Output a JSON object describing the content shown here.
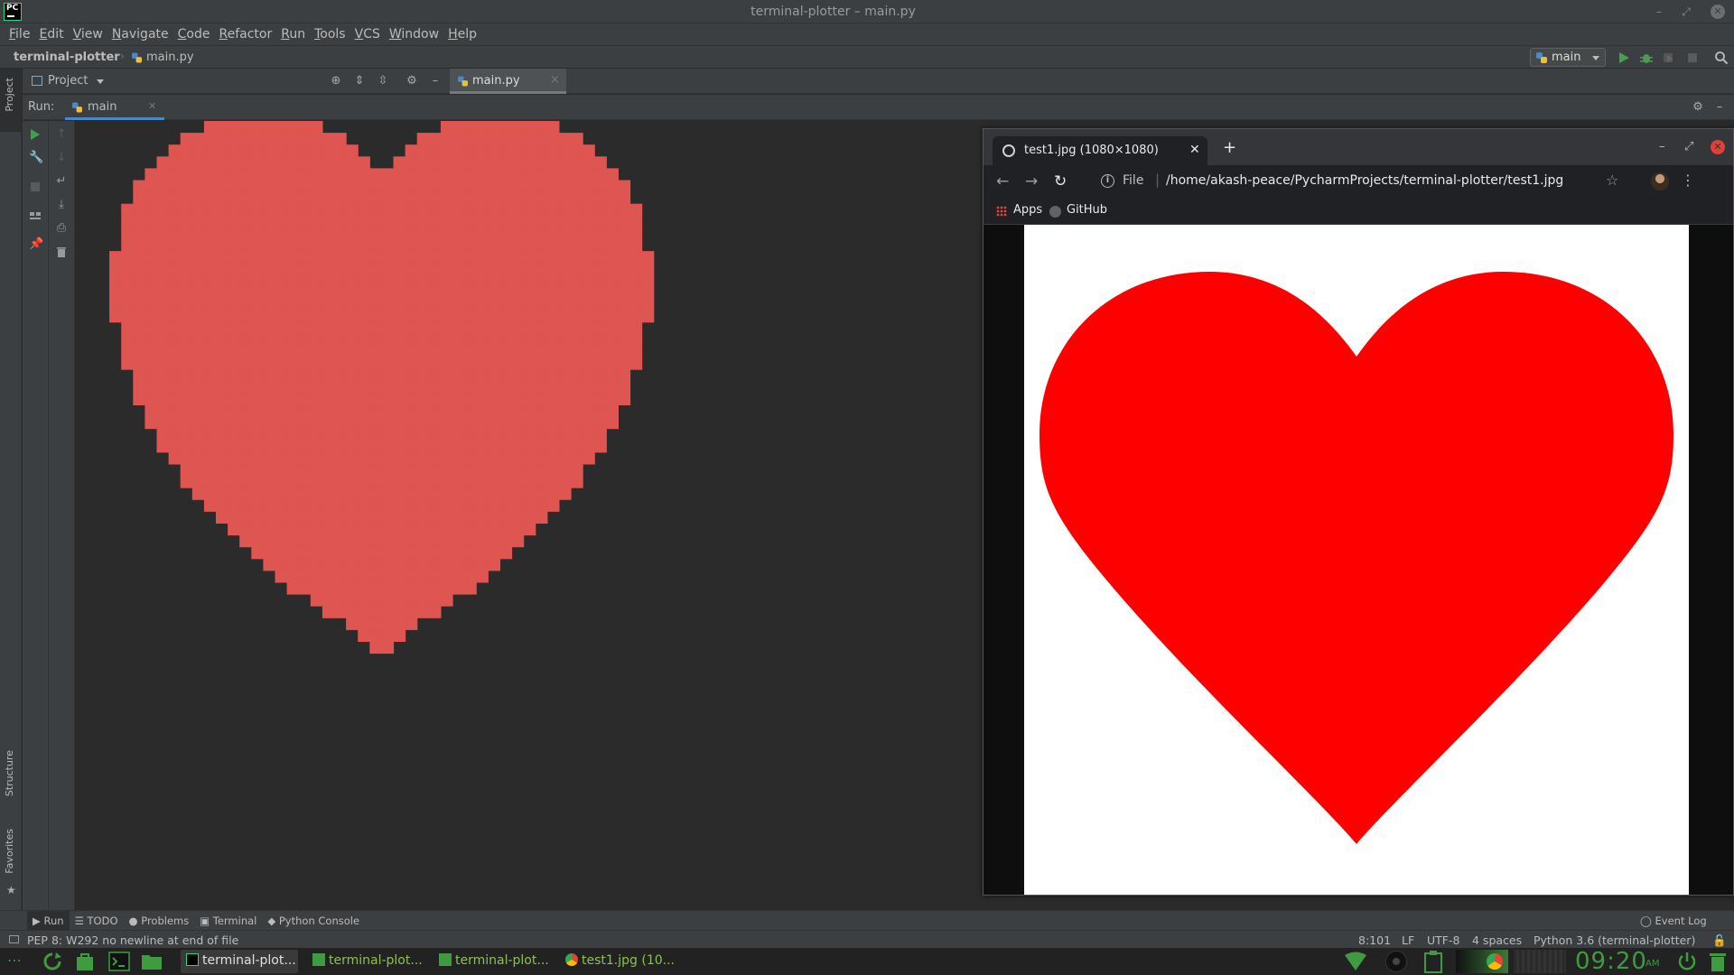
{
  "window": {
    "title": "terminal-plotter – main.py"
  },
  "menu": [
    "File",
    "Edit",
    "View",
    "Navigate",
    "Code",
    "Refactor",
    "Run",
    "Tools",
    "VCS",
    "Window",
    "Help"
  ],
  "breadcrumb": {
    "project": "terminal-plotter",
    "file": "main.py"
  },
  "run_config": {
    "label": "main"
  },
  "left_stripe": {
    "project": "Project",
    "structure": "Structure",
    "favorites": "Favorites"
  },
  "project_panel": {
    "label": "Project"
  },
  "editor_tab": {
    "label": "main.py"
  },
  "run_panel": {
    "title": "Run:",
    "tab_label": "main"
  },
  "console_plot": {
    "color": "#de5551",
    "shape": "heart"
  },
  "browser": {
    "tab_title": "test1.jpg (1080×1080)",
    "url_scheme": "File",
    "url": "/home/akash-peace/PycharmProjects/terminal-plotter/test1.jpg",
    "bookmarks": [
      "Apps",
      "GitHub"
    ],
    "image_color": "#ff0000"
  },
  "bottom_tools": [
    "Run",
    "TODO",
    "Problems",
    "Terminal",
    "Python Console"
  ],
  "event_log": "Event Log",
  "status": {
    "message": "PEP 8: W292 no newline at end of file",
    "position": "8:101",
    "line_sep": "LF",
    "encoding": "UTF-8",
    "indent": "4 spaces",
    "interpreter": "Python 3.6 (terminal-plotter)"
  },
  "taskbar": {
    "tasks": [
      "terminal-plot...",
      "terminal-plot...",
      "terminal-plot...",
      "test1.jpg (10..."
    ],
    "clock": "09:20",
    "ampm": "AM"
  }
}
